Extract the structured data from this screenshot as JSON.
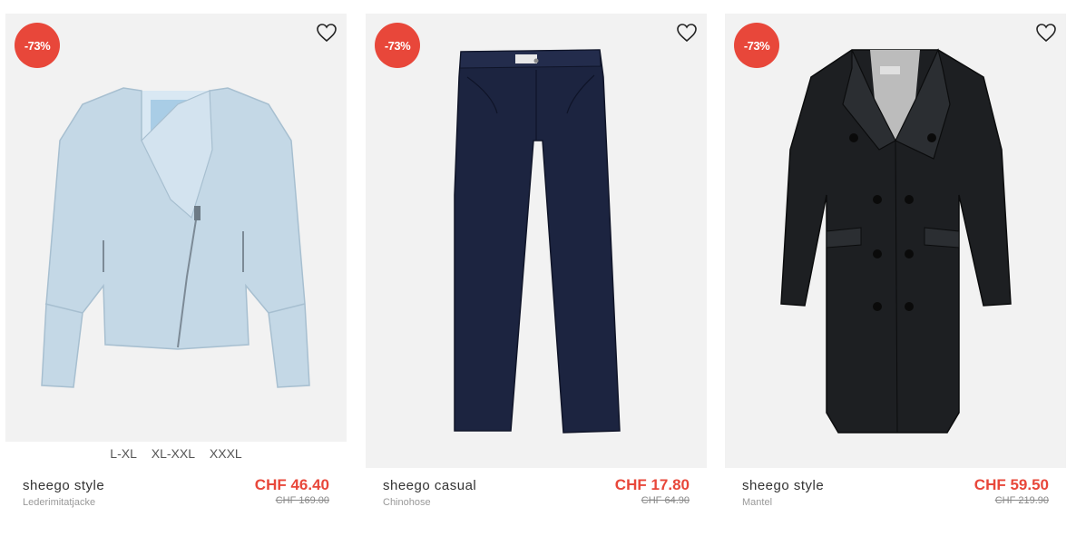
{
  "products": [
    {
      "discount": "-73%",
      "sizes": [
        "L-XL",
        "XL-XXL",
        "XXXL"
      ],
      "brand": "sheego style",
      "name": "Lederimitatjacke",
      "price": "CHF 46.40",
      "old_price": "CHF 169.00",
      "image_icon": "light-blue-jacket",
      "wishlist_icon": "heart-icon"
    },
    {
      "discount": "-73%",
      "brand": "sheego casual",
      "name": "Chinohose",
      "price": "CHF 17.80",
      "old_price": "CHF 64.90",
      "image_icon": "navy-trousers",
      "wishlist_icon": "heart-icon"
    },
    {
      "discount": "-73%",
      "brand": "sheego style",
      "name": "Mantel",
      "price": "CHF 59.50",
      "old_price": "CHF 219.90",
      "image_icon": "black-coat",
      "wishlist_icon": "heart-icon"
    }
  ],
  "colors": {
    "accent": "#e8473a",
    "image_background": "#f2f2f2"
  }
}
